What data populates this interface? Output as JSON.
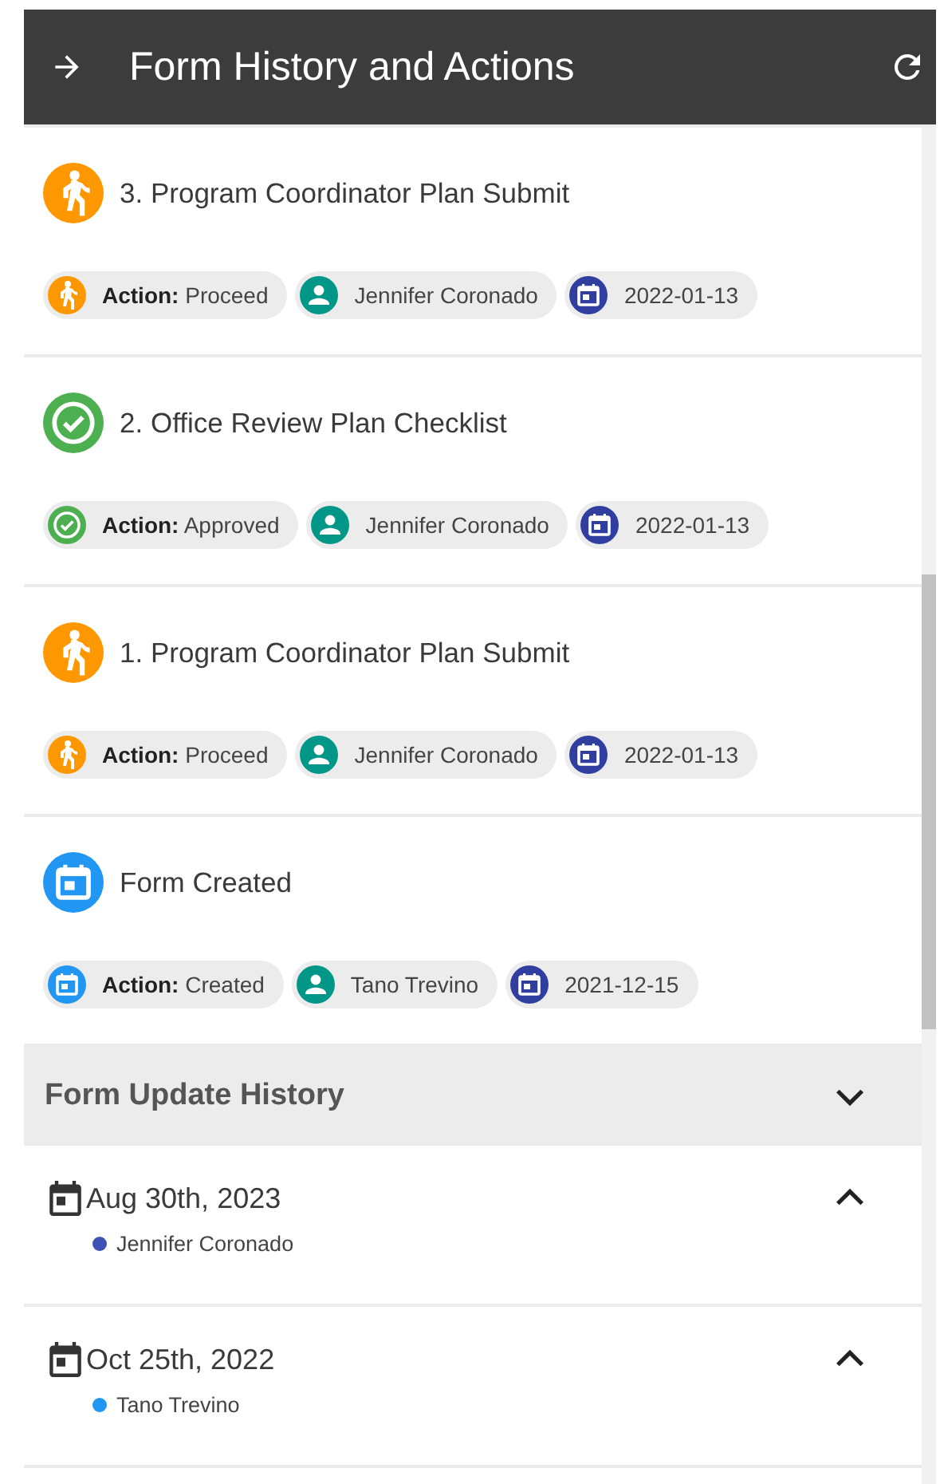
{
  "header": {
    "title": "Form History and Actions"
  },
  "entries": [
    {
      "kind": "proceed",
      "title": "3. Program Coordinator Plan Submit",
      "action_label": "Action:",
      "action": "Proceed",
      "user": "Jennifer Coronado",
      "date": "2022-01-13"
    },
    {
      "kind": "approved",
      "title": "2. Office Review Plan Checklist",
      "action_label": "Action:",
      "action": "Approved",
      "user": "Jennifer Coronado",
      "date": "2022-01-13"
    },
    {
      "kind": "proceed",
      "title": "1. Program Coordinator Plan Submit",
      "action_label": "Action:",
      "action": "Proceed",
      "user": "Jennifer Coronado",
      "date": "2022-01-13"
    },
    {
      "kind": "created",
      "title": "Form Created",
      "action_label": "Action:",
      "action": "Created",
      "user": "Tano Trevino",
      "date": "2021-12-15"
    }
  ],
  "update_history": {
    "title": "Form Update History",
    "items": [
      {
        "date": "Aug 30th, 2023",
        "user": "Jennifer Coronado",
        "color": "#3f51b5"
      },
      {
        "date": "Oct 25th, 2022",
        "user": "Tano Trevino",
        "color": "#2196f3"
      }
    ]
  }
}
